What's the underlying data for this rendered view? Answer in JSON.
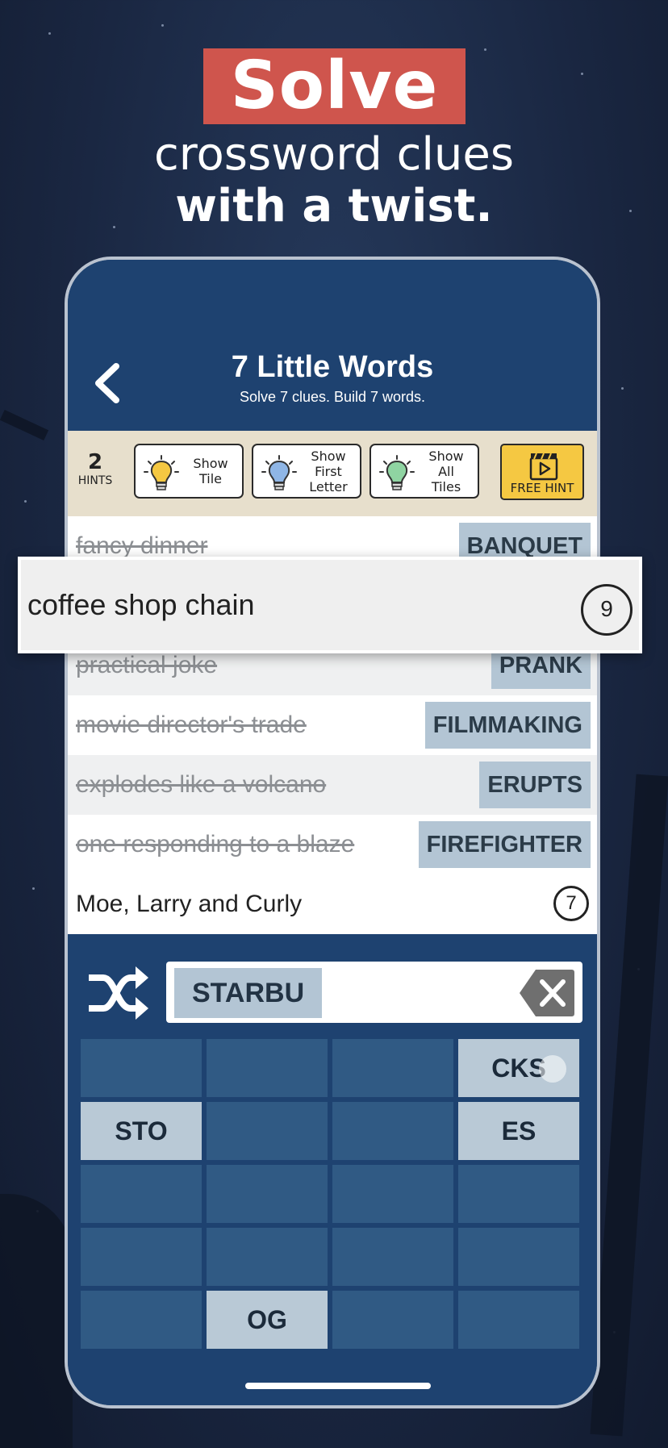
{
  "promo": {
    "word1": "Solve",
    "line2": "crossword clues",
    "line3": "with a twist."
  },
  "app": {
    "title": "7 Little Words",
    "subtitle": "Solve 7 clues. Build 7 words."
  },
  "hints": {
    "count": "2",
    "count_label": "HINTS",
    "buttons": [
      {
        "label": "Show\nTile",
        "icon": "lightbulb-yellow-icon",
        "color": "#f5c842"
      },
      {
        "label": "Show\nFirst\nLetter",
        "icon": "lightbulb-blue-icon",
        "color": "#8fb6e6"
      },
      {
        "label": "Show\nAll\nTiles",
        "icon": "lightbulb-green-icon",
        "color": "#8fd4a2"
      }
    ],
    "free_hint_label": "FREE HINT",
    "free_hint_icon": "video-play-icon"
  },
  "clues": [
    {
      "text": "fancy dinner",
      "answer": "BANQUET",
      "solved": true
    },
    {
      "text": "practical joke",
      "answer": "PRANK",
      "solved": true
    },
    {
      "text": "movie director's trade",
      "answer": "FILMMAKING",
      "solved": true
    },
    {
      "text": "explodes like a volcano",
      "answer": "ERUPTS",
      "solved": true
    },
    {
      "text": "one responding to a blaze",
      "answer": "FIREFIGHTER",
      "solved": true
    },
    {
      "text": "Moe, Larry and Curly",
      "length": "7",
      "solved": false
    }
  ],
  "active_clue": {
    "text": "coffee shop chain",
    "length": "9"
  },
  "tray": {
    "current_entry": "STARBU",
    "shuffle_icon": "shuffle-icon",
    "backspace_icon": "backspace-icon",
    "tiles": [
      [
        "",
        "",
        "",
        "CKS"
      ],
      [
        "STO",
        "",
        "",
        "ES"
      ],
      [
        "",
        "",
        "",
        ""
      ],
      [
        "",
        "",
        "",
        ""
      ],
      [
        "",
        "OG",
        "",
        ""
      ]
    ]
  },
  "colors": {
    "accent_red": "#cf554d",
    "nav_blue": "#1e4270",
    "answer_tile": "#b3c5d4",
    "hint_bar": "#e7dfcc",
    "free_hint_yellow": "#f5c842"
  }
}
